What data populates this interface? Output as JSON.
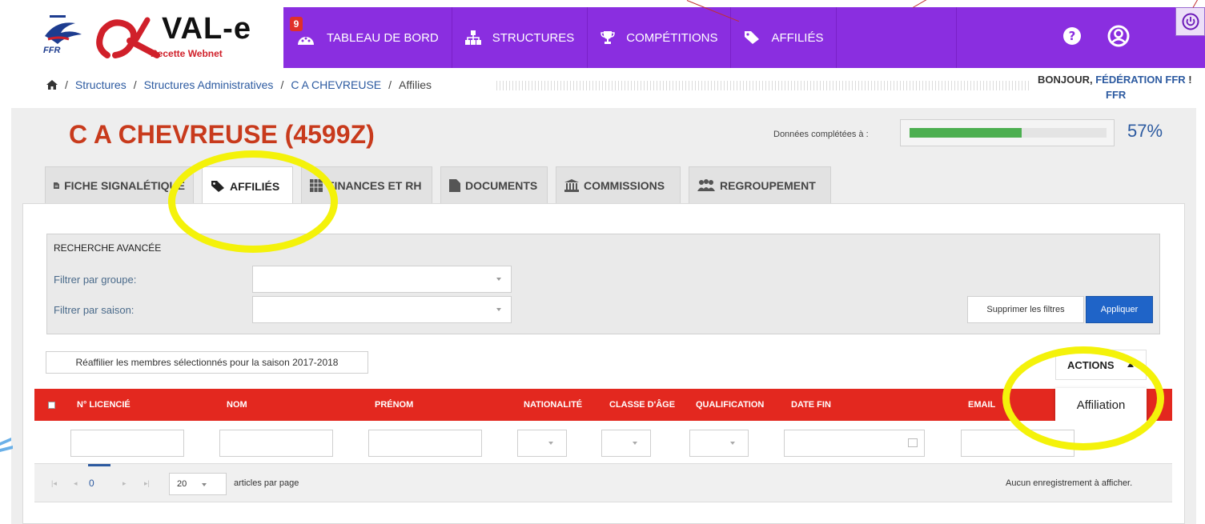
{
  "app": {
    "brand_title": "VAL-e",
    "brand_subtitle": "Recette Webnet",
    "ffr_label": "FFR"
  },
  "nav": {
    "items": [
      {
        "label": "TABLEAU DE BORD",
        "icon": "dashboard-icon",
        "badge": "9"
      },
      {
        "label": "STRUCTURES",
        "icon": "sitemap-icon"
      },
      {
        "label": "COMPÉTITIONS",
        "icon": "trophy-icon"
      },
      {
        "label": "AFFILIÉS",
        "icon": "tag-icon"
      }
    ]
  },
  "breadcrumb": {
    "items": [
      "Structures",
      "Structures Administratives",
      "C A CHEVREUSE"
    ],
    "current": "Affilies",
    "separator": "/"
  },
  "greeting": {
    "prefix": "BONJOUR, ",
    "org": "FÉDÉRATION FFR",
    "suffix": " !",
    "line2": "FFR"
  },
  "page": {
    "title": "C A CHEVREUSE (4599Z)",
    "progress_label": "Données complétées à :",
    "progress_value": 57,
    "progress_text": "57%"
  },
  "tabs": [
    {
      "label": "FICHE SIGNALÉTIQUE",
      "icon": "file-icon"
    },
    {
      "label": "AFFILIÉS",
      "icon": "tag-icon",
      "active": true
    },
    {
      "label": "FINANCES ET RH",
      "icon": "table-icon"
    },
    {
      "label": "DOCUMENTS",
      "icon": "document-icon"
    },
    {
      "label": "COMMISSIONS",
      "icon": "bank-icon"
    },
    {
      "label": "REGROUPEMENT",
      "icon": "group-icon"
    }
  ],
  "search": {
    "title": "RECHERCHE AVANCÉE",
    "group_label": "Filtrer par groupe:",
    "season_label": "Filtrer par saison:",
    "group_value": "",
    "season_value": "",
    "clear_label": "Supprimer les filtres",
    "apply_label": "Appliquer"
  },
  "actions": {
    "reaffiliate_label": "Réaffilier les membres sélectionnés pour la saison 2017-2018",
    "actions_label": "ACTIONS",
    "menu_items": [
      "Affiliation"
    ]
  },
  "table": {
    "columns": [
      "N° LICENCIÉ",
      "NOM",
      "PRÉNOM",
      "NATIONALITÉ",
      "CLASSE D'ÂGE",
      "QUALIFICATION",
      "DATE FIN",
      "EMAIL"
    ],
    "rows": []
  },
  "pager": {
    "page": "0",
    "page_size": "20",
    "page_size_label": "articles par page",
    "empty_text": "Aucun enregistrement à afficher."
  },
  "colors": {
    "nav_bg": "#8a2ee0",
    "header_red": "#e3281f",
    "title_red": "#c83a1c",
    "link_blue": "#2c5aa0",
    "apply_blue": "#1f64c8",
    "progress_green": "#4caf50",
    "highlight_yellow": "#f4f20a"
  }
}
